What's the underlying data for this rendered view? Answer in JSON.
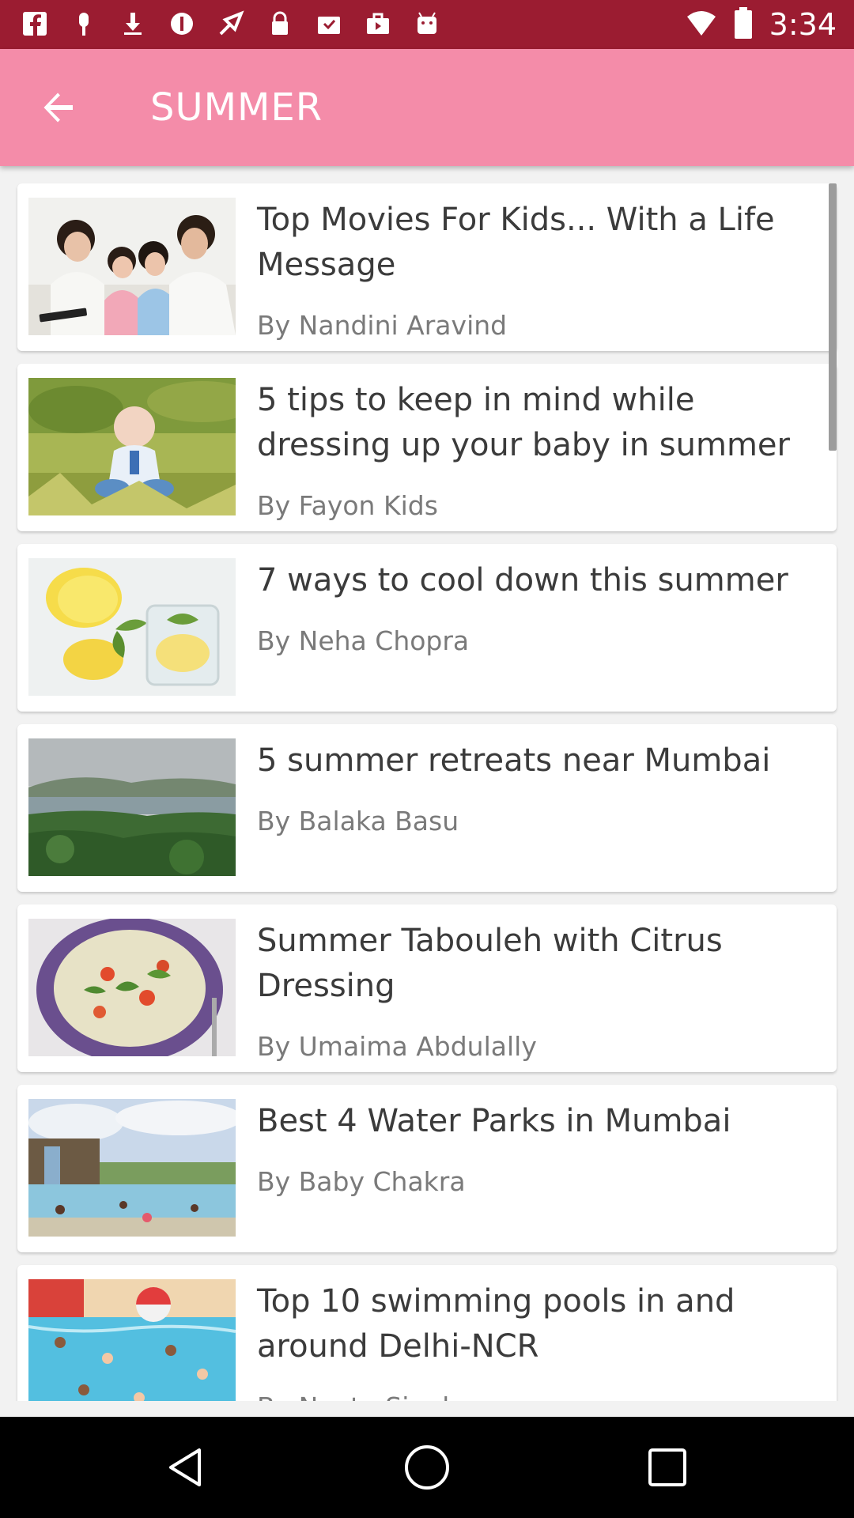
{
  "status_bar": {
    "time": "3:34",
    "icons": [
      "facebook-icon",
      "clip-icon",
      "download-icon",
      "blocked-icon",
      "fake-gps-icon",
      "lock-icon",
      "inbox-icon",
      "briefcase-icon",
      "android-icon",
      "wifi-icon",
      "battery-icon"
    ],
    "color": "#9b1c31"
  },
  "header": {
    "title": "SUMMER",
    "back_icon": "arrow-left-icon",
    "color": "#f48ca9"
  },
  "articles": [
    {
      "title": "Top Movies For Kids... With a Life Message",
      "author": "By Nandini Aravind",
      "image": "family-watching-tablet"
    },
    {
      "title": "5 tips to keep in mind while dressing up your baby in summer",
      "author": "By Fayon Kids",
      "image": "baby-on-grass"
    },
    {
      "title": "7 ways to cool down this summer",
      "author": "By Neha Chopra",
      "image": "lemon-water"
    },
    {
      "title": "5 summer retreats near Mumbai",
      "author": "By Balaka Basu",
      "image": "lake-landscape"
    },
    {
      "title": "Summer Tabouleh with Citrus Dressing",
      "author": "By Umaima Abdulally",
      "image": "tabouleh-bowl"
    },
    {
      "title": "Best 4 Water Parks in Mumbai",
      "author": "By Baby Chakra",
      "image": "water-park"
    },
    {
      "title": "Top 10 swimming pools in and around Delhi-NCR",
      "author": "By Neetu Singh",
      "image": "swimming-pool"
    }
  ],
  "nav_bar": {
    "icons": [
      "back-triangle-icon",
      "home-circle-icon",
      "recents-square-icon"
    ]
  }
}
